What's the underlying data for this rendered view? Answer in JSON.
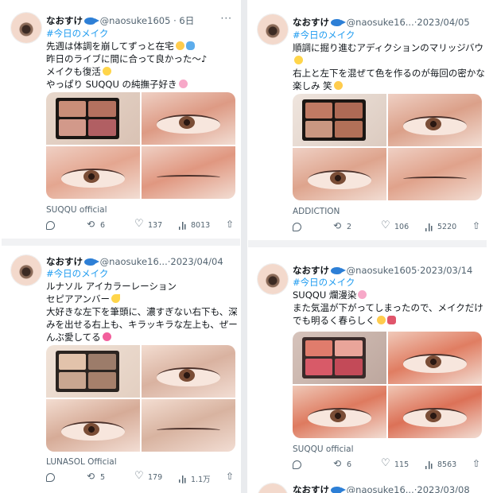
{
  "posts": [
    {
      "user": "なおすけ",
      "handle": "@naosuke1605",
      "date": "6日",
      "hashtag": "#今日のメイク",
      "lines": [
        "先週は体調を崩してずっと在宅",
        "昨日のライブに間に合って良かった〜♪",
        "メイクも復活",
        "やっぱり SUQQU の純撫子好き"
      ],
      "source": "SUQQU official",
      "retweets": "6",
      "likes": "137",
      "views": "8013",
      "pans": [
        "#c98e78",
        "#b3715f",
        "#d2998a",
        "#b15f63"
      ]
    },
    {
      "user": "なおすけ",
      "handle": "@naosuke16...",
      "date": "2023/04/05",
      "hashtag": "#今日のメイク",
      "lines": [
        "順調に掘り進むアディクションのマリッジバウ",
        "",
        "右上と左下を混ぜて色を作るのが毎回の密かな",
        "楽しみ 笑"
      ],
      "source": "ADDICTION",
      "retweets": "2",
      "likes": "106",
      "views": "5220",
      "pans": [
        "#c07a63",
        "#ae6a55",
        "#c99781",
        "#b27058"
      ]
    },
    {
      "user": "なおすけ",
      "handle": "@naosuke16...",
      "date": "2023/04/04",
      "hashtag": "#今日のメイク",
      "lines": [
        "ルナソル アイカラーレーション",
        "セピアアンバー",
        "大好きな左下を筆頭に、濃すぎない右下も、深",
        "みを出せる右上も、キラッキラな左上も、ぜー",
        "んぶ愛してる"
      ],
      "source": "LUNASOL Official",
      "retweets": "5",
      "likes": "179",
      "views": "1.1万",
      "pans": [
        "#e2c3ab",
        "#9c7c6a",
        "#c9a690",
        "#a6806b"
      ]
    },
    {
      "user": "なおすけ",
      "handle": "@naosuke1605",
      "date": "2023/03/14",
      "hashtag": "#今日のメイク",
      "lines": [
        "SUQQU 爛漫染",
        "また気温が下がってしまったので、メイクだけ",
        "でも明るく春らしく"
      ],
      "source": "SUQQU official",
      "retweets": "6",
      "likes": "115",
      "views": "8563",
      "pans": [
        "#e07c6c",
        "#e9a59a",
        "#d85a68",
        "#c34a58"
      ]
    }
  ],
  "peek": {
    "user": "なおすけ",
    "handle": "@naosuke16...",
    "date": "2023/03/08"
  },
  "sep": "·",
  "more": "···"
}
